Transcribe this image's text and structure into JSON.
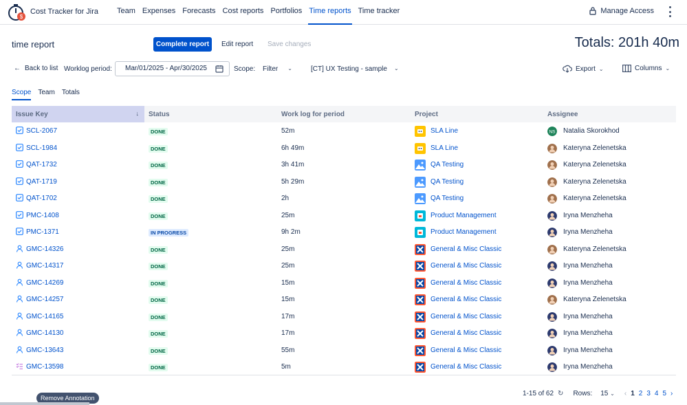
{
  "app": {
    "name": "Cost Tracker for Jira"
  },
  "nav": {
    "items": [
      "Team",
      "Expenses",
      "Forecasts",
      "Cost reports",
      "Portfolios",
      "Time reports",
      "Time tracker"
    ],
    "active_index": 5,
    "manage_access": "Manage Access"
  },
  "header": {
    "title": "time report",
    "complete_report": "Complete report",
    "edit_report": "Edit report",
    "save_changes": "Save changes",
    "totals": "Totals: 201h 40m"
  },
  "filters": {
    "back": "Back to list",
    "worklog_label": "Worklog period:",
    "date_range": "Mar/01/2025 - Apr/30/2025",
    "scope_label": "Scope:",
    "scope_filter": "Filter",
    "project": "[CT] UX Testing - sample",
    "export": "Export",
    "columns": "Columns"
  },
  "subtabs": [
    "Scope",
    "Team",
    "Totals"
  ],
  "table": {
    "headers": [
      "Issue Key",
      "Status",
      "Work log for period",
      "Project",
      "Assignee"
    ],
    "rows": [
      {
        "key": "SCL-2067",
        "type": "task",
        "status": "DONE",
        "worklog": "52m",
        "project": "SLA Line",
        "proj_icon": "sla",
        "assignee": "Natalia Skorokhod",
        "avatar": "ns"
      },
      {
        "key": "SCL-1984",
        "type": "task",
        "status": "DONE",
        "worklog": "6h 49m",
        "project": "SLA Line",
        "proj_icon": "sla",
        "assignee": "Kateryna Zelenetska",
        "avatar": "kz"
      },
      {
        "key": "QAT-1732",
        "type": "task",
        "status": "DONE",
        "worklog": "3h 41m",
        "project": "QA Testing",
        "proj_icon": "qa",
        "assignee": "Kateryna Zelenetska",
        "avatar": "kz"
      },
      {
        "key": "QAT-1719",
        "type": "task",
        "status": "DONE",
        "worklog": "5h 29m",
        "project": "QA Testing",
        "proj_icon": "qa",
        "assignee": "Kateryna Zelenetska",
        "avatar": "kz"
      },
      {
        "key": "QAT-1702",
        "type": "task",
        "status": "DONE",
        "worklog": "2h",
        "project": "QA Testing",
        "proj_icon": "qa",
        "assignee": "Kateryna Zelenetska",
        "avatar": "kz"
      },
      {
        "key": "PMC-1408",
        "type": "task",
        "status": "DONE",
        "worklog": "25m",
        "project": "Product Management",
        "proj_icon": "pm",
        "assignee": "Iryna Menzheha",
        "avatar": "im"
      },
      {
        "key": "PMC-1371",
        "type": "task",
        "status": "IN PROGRESS",
        "worklog": "9h 2m",
        "project": "Product Management",
        "proj_icon": "pm",
        "assignee": "Iryna Menzheha",
        "avatar": "im"
      },
      {
        "key": "GMC-14326",
        "type": "user",
        "status": "DONE",
        "worklog": "25m",
        "project": "General & Misc Classic",
        "proj_icon": "gm",
        "assignee": "Kateryna Zelenetska",
        "avatar": "kz"
      },
      {
        "key": "GMC-14317",
        "type": "user",
        "status": "DONE",
        "worklog": "25m",
        "project": "General & Misc Classic",
        "proj_icon": "gm",
        "assignee": "Iryna Menzheha",
        "avatar": "im"
      },
      {
        "key": "GMC-14269",
        "type": "user",
        "status": "DONE",
        "worklog": "15m",
        "project": "General & Misc Classic",
        "proj_icon": "gm",
        "assignee": "Iryna Menzheha",
        "avatar": "im"
      },
      {
        "key": "GMC-14257",
        "type": "user",
        "status": "DONE",
        "worklog": "15m",
        "project": "General & Misc Classic",
        "proj_icon": "gm",
        "assignee": "Kateryna Zelenetska",
        "avatar": "kz"
      },
      {
        "key": "GMC-14165",
        "type": "user",
        "status": "DONE",
        "worklog": "17m",
        "project": "General & Misc Classic",
        "proj_icon": "gm",
        "assignee": "Iryna Menzheha",
        "avatar": "im"
      },
      {
        "key": "GMC-14130",
        "type": "user",
        "status": "DONE",
        "worklog": "17m",
        "project": "General & Misc Classic",
        "proj_icon": "gm",
        "assignee": "Iryna Menzheha",
        "avatar": "im"
      },
      {
        "key": "GMC-13643",
        "type": "user",
        "status": "DONE",
        "worklog": "55m",
        "project": "General & Misc Classic",
        "proj_icon": "gm",
        "assignee": "Iryna Menzheha",
        "avatar": "im"
      },
      {
        "key": "GMC-13598",
        "type": "subtask",
        "status": "DONE",
        "worklog": "5m",
        "project": "General & Misc Classic",
        "proj_icon": "gm",
        "assignee": "Iryna Menzheha",
        "avatar": "im"
      }
    ]
  },
  "footer": {
    "tooltip": "Remove Annotation",
    "range": "1-15 of 62",
    "rows_label": "Rows:",
    "rows_value": "15",
    "pages": [
      "1",
      "2",
      "3",
      "4",
      "5"
    ],
    "current_page": "1"
  },
  "avatar_initials": {
    "ns": "NS"
  },
  "colors": {
    "primary": "#0052cc",
    "done_text": "#006644",
    "done_bg": "#e3fcef",
    "progress_bg": "#deebff",
    "header_key_bg": "#d0d4f0",
    "ns_avatar": "#1f845a",
    "kz_avatar": "#a0704c",
    "im_avatar": "#2d3a6e"
  }
}
